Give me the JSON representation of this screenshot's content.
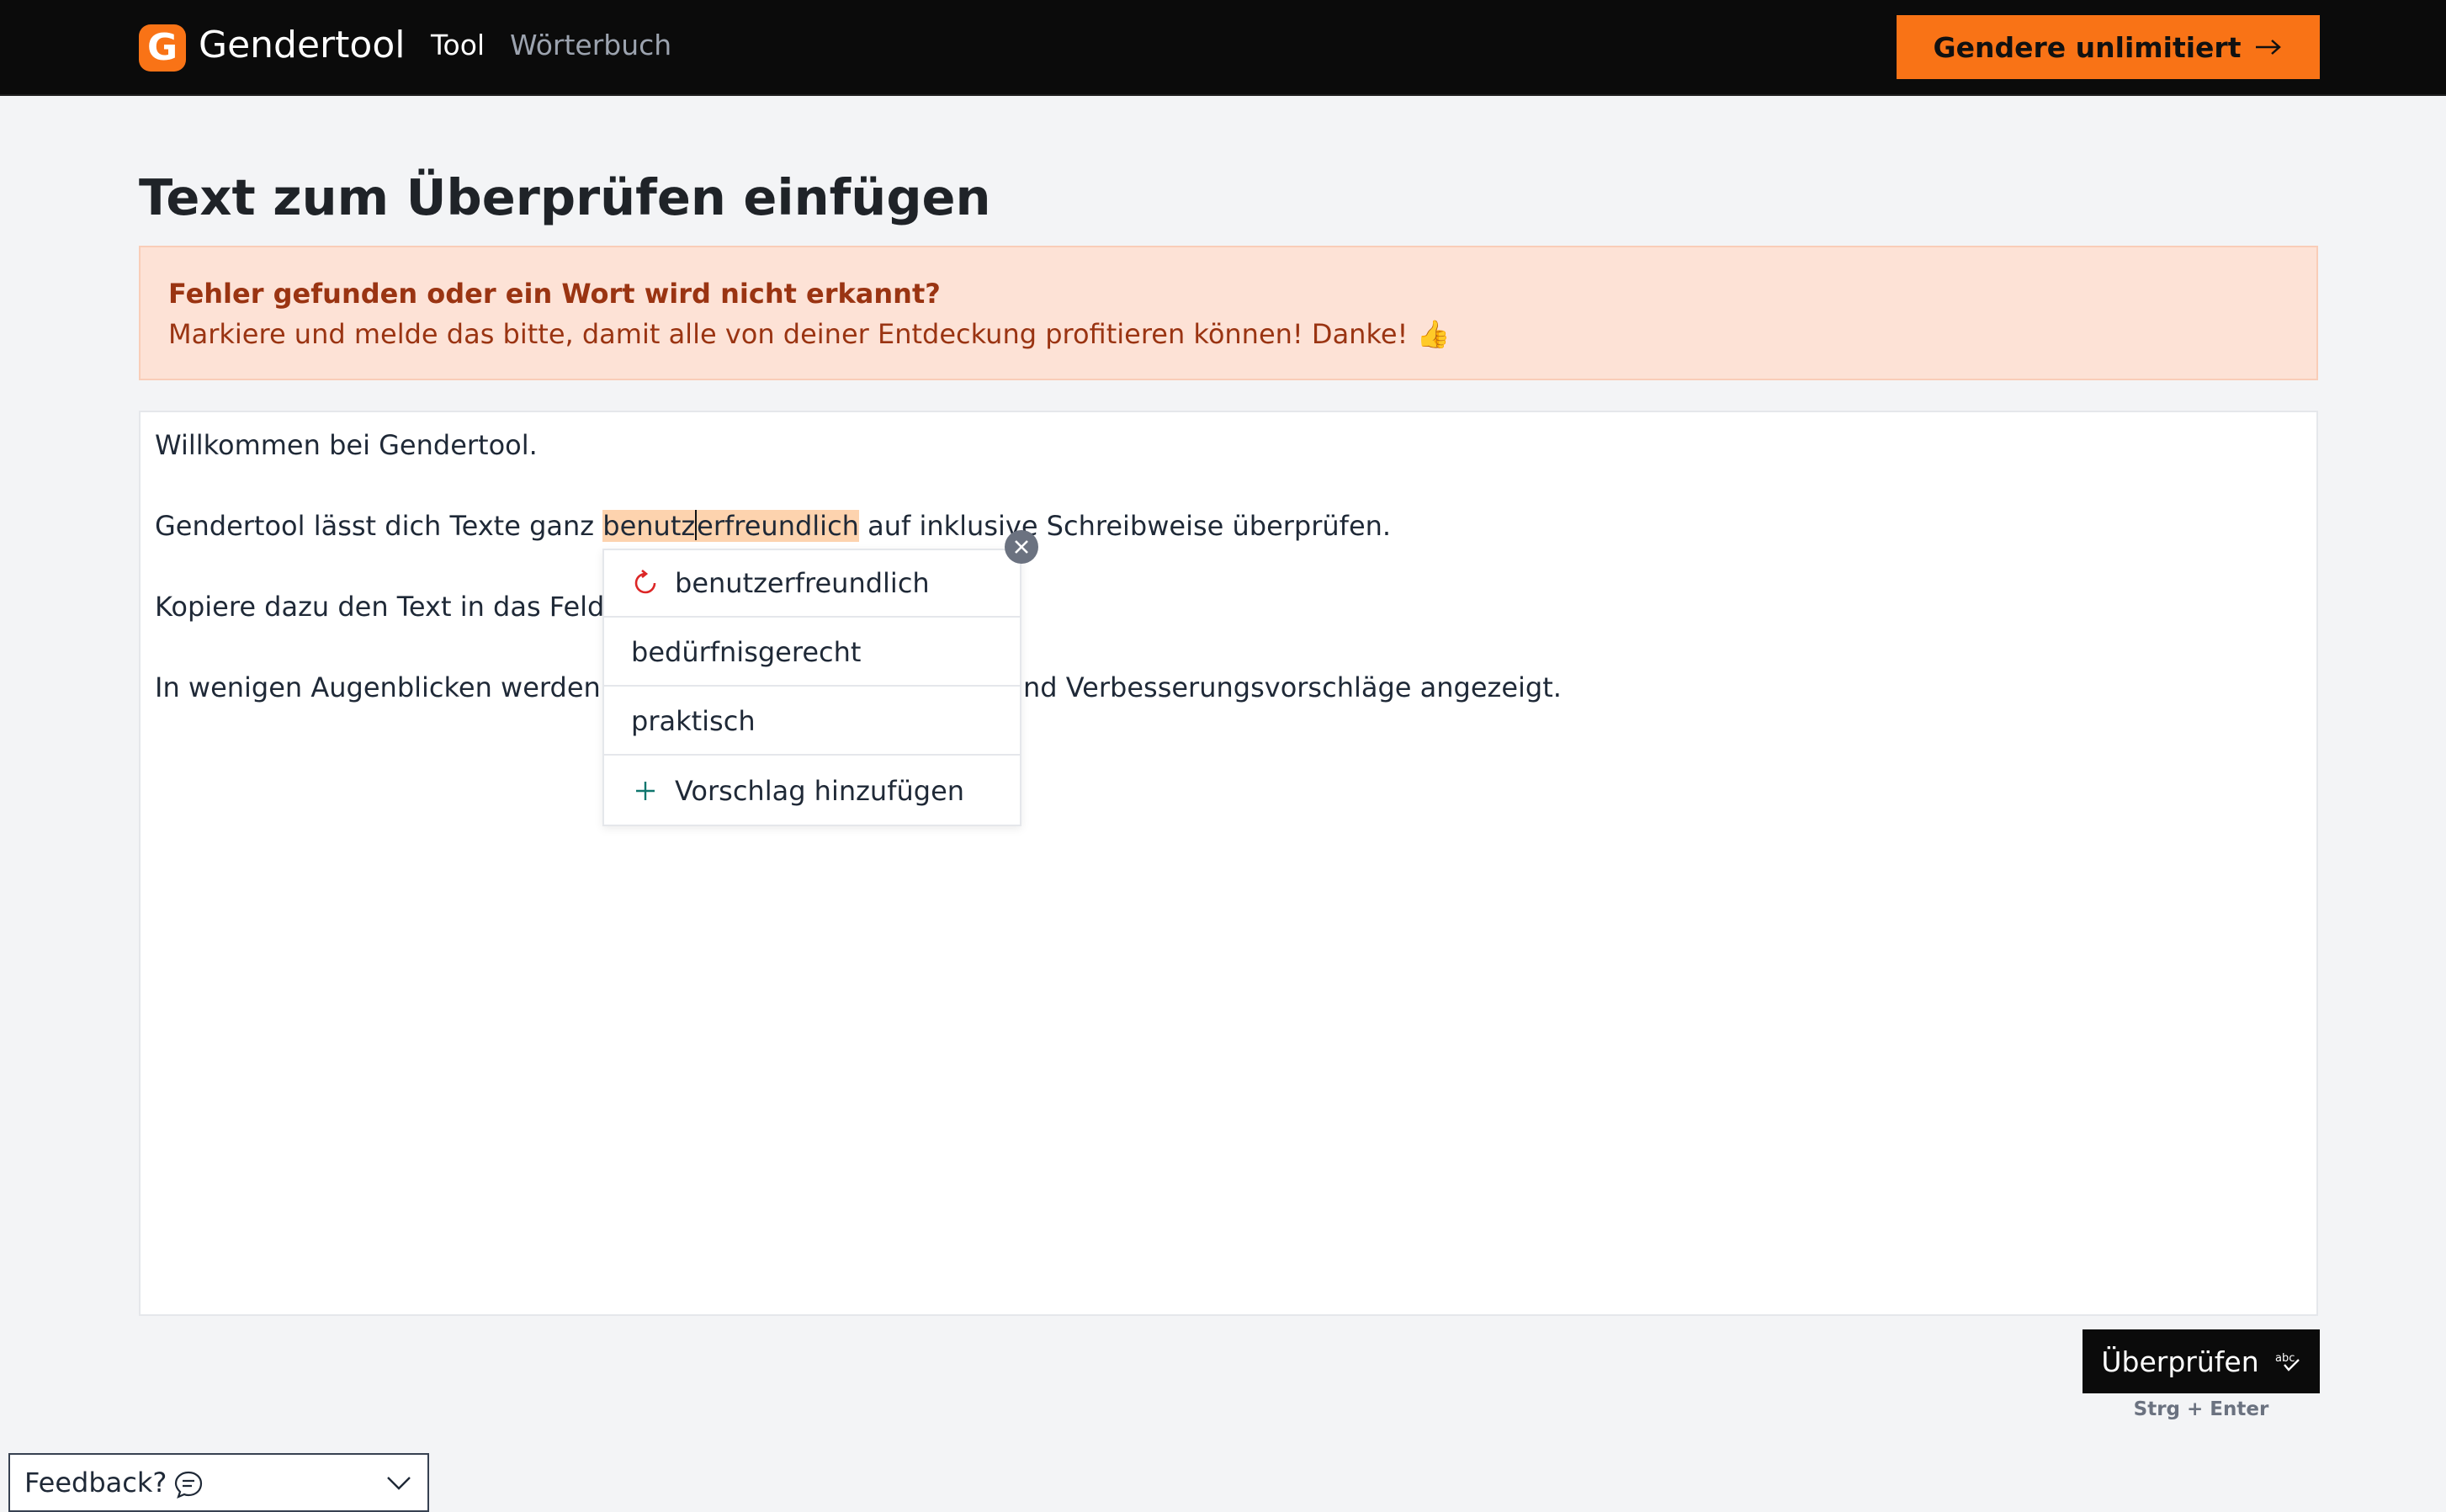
{
  "header": {
    "logo_letter": "G",
    "logo_text": "Gendertool",
    "nav": [
      {
        "label": "Tool",
        "active": true
      },
      {
        "label": "Wörterbuch",
        "active": false
      }
    ],
    "cta_label": "Gendere unlimitiert"
  },
  "main": {
    "title": "Text zum Überprüfen einfügen",
    "banner": {
      "title": "Fehler gefunden oder ein Wort wird nicht erkannt?",
      "text": "Markiere und melde das bitte, damit alle von deiner Entdeckung profitieren können! Danke! 👍"
    }
  },
  "editor": {
    "line1": "Willkommen bei Gendertool.",
    "line2_before": "Gendertool lässt dich Texte ganz ",
    "line2_mark_a": "benutz",
    "line2_mark_b": "erfreundlich",
    "line2_after": " auf inklusive Schreibweise überprüfen.",
    "line3_visible": "Kopiere dazu den Text in das Feld",
    "line4_left": "In wenigen Augenblicken werden",
    "line4_right": "nd Verbesserungsvorschläge angezeigt."
  },
  "suggestions": {
    "items": [
      {
        "label": "benutzerfreundlich",
        "icon": "reset-icon"
      },
      {
        "label": "bedürfnisgerecht"
      },
      {
        "label": "praktisch"
      }
    ],
    "add_label": "Vorschlag hinzufügen"
  },
  "actions": {
    "check_label": "Überprüfen",
    "shortcut": "Strg + Enter"
  },
  "feedback": {
    "label": "Feedback?"
  },
  "colors": {
    "accent": "#f97316",
    "topbar": "#0b0b0b",
    "highlight": "#fdd3ae",
    "banner_bg": "#fde2d6",
    "banner_text": "#9a3412"
  }
}
